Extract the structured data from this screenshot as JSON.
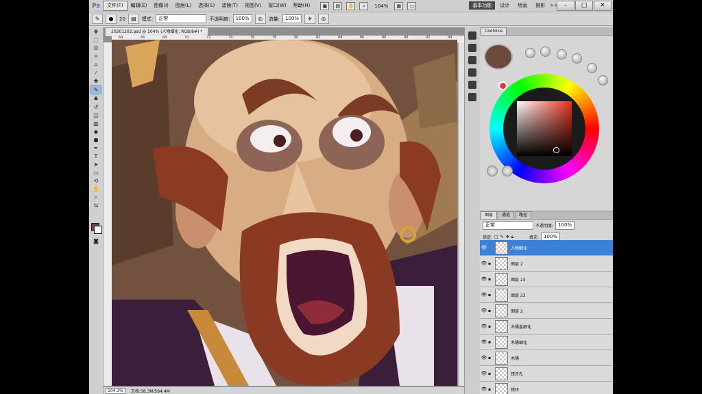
{
  "menu": {
    "app_logo": "Ps",
    "items": [
      "文件(F)",
      "编辑(E)",
      "图像(I)",
      "图层(L)",
      "选择(S)",
      "滤镜(T)",
      "视图(V)",
      "窗口(W)",
      "帮助(H)"
    ],
    "zoom_readout": "104%",
    "workspaces": [
      "基本功能",
      "设计",
      "绘画",
      "摄影"
    ],
    "more": ">>"
  },
  "window_controls": {
    "minimize": "–",
    "maximize": "□",
    "close": "✕"
  },
  "options": {
    "brush_size": "20",
    "mode_label": "模式:",
    "mode_value": "正常",
    "opacity_label": "不透明度:",
    "opacity_value": "100%",
    "flow_label": "流量:",
    "flow_value": "100%"
  },
  "document": {
    "tab_title": "20201202.psd @ 104% (人物细化, RGB/8#) *",
    "ruler_marks": [
      "64",
      "66",
      "68",
      "70",
      "72",
      "74",
      "76",
      "78",
      "80",
      "82",
      "84",
      "86",
      "88",
      "90",
      "92",
      "94"
    ],
    "status_zoom": "104.3%",
    "status_doc": "文档:58.3M/594.4M"
  },
  "coolorus": {
    "tab": "Coolorus",
    "swatch_color": "#6b4a3d"
  },
  "layers_panel": {
    "tabs": [
      "图层",
      "通道",
      "路径"
    ],
    "blend_mode": "正常",
    "opacity_label": "不透明度:",
    "opacity_value": "100%",
    "lock_label": "锁定:",
    "fill_label": "填充:",
    "fill_value": "100%",
    "layers": [
      {
        "name": "人物细化",
        "selected": true
      },
      {
        "name": "图层 2",
        "selected": false
      },
      {
        "name": "图层 24",
        "selected": false
      },
      {
        "name": "图层 23",
        "selected": false
      },
      {
        "name": "图层 2",
        "selected": false
      },
      {
        "name": "木桶盖细化",
        "selected": false
      },
      {
        "name": "木桶细化",
        "selected": false
      },
      {
        "name": "木桶",
        "selected": false
      },
      {
        "name": "锈牙孔",
        "selected": false
      },
      {
        "name": "锈环",
        "selected": false
      }
    ]
  },
  "colors": {
    "accent_selected": "#3b82d6",
    "fg": "#6b4a3d"
  }
}
